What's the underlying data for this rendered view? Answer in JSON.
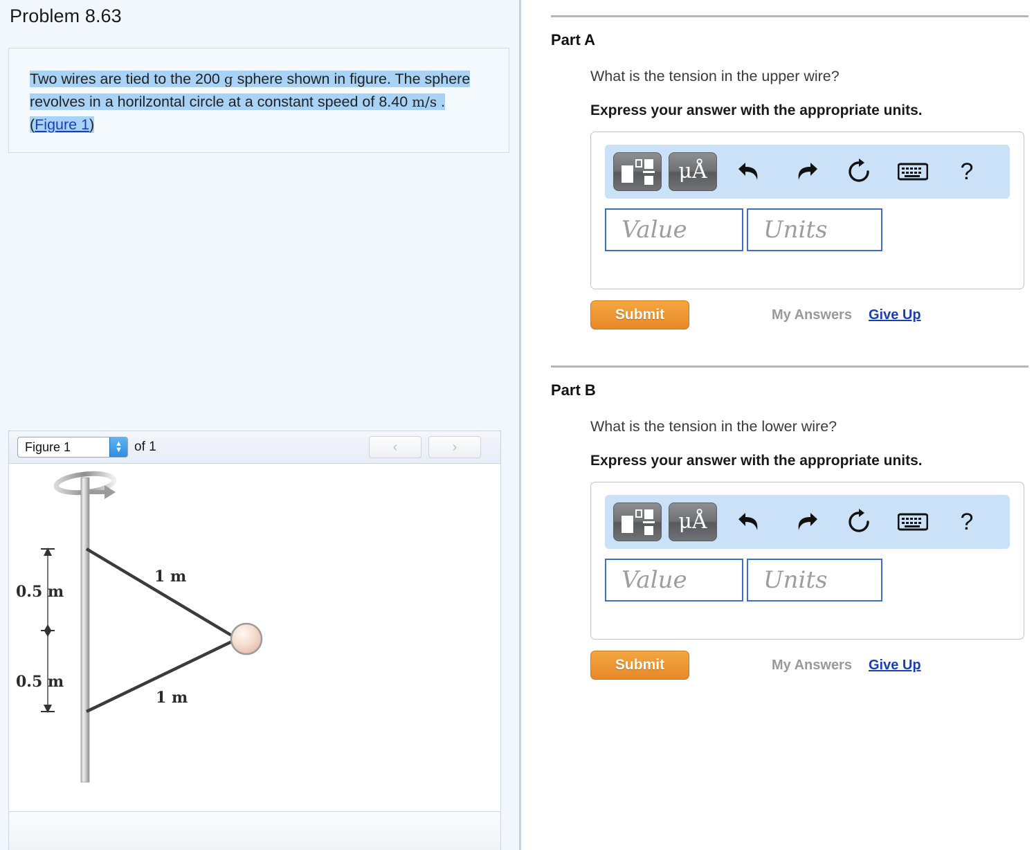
{
  "problem": {
    "title": "Problem 8.63",
    "statement_pre": "Two wires are tied to the 200 ",
    "statement_g": "g",
    "statement_mid": " sphere shown in figure. The sphere revolves in a horilzontal circle at a constant speed of 8.40 ",
    "statement_units": "m/s",
    "statement_post": " . (",
    "figure_link": "Figure 1",
    "statement_end": ")"
  },
  "figure": {
    "select_value": "Figure 1",
    "of_label": "of 1",
    "prev_icon": "chevron-left-icon",
    "next_icon": "chevron-right-icon",
    "diagram": {
      "upper_wire_label": "1 m",
      "lower_wire_label": "1 m",
      "upper_dim_label": "0.5 m",
      "lower_dim_label": "0.5 m"
    }
  },
  "parts": [
    {
      "heading": "Part A",
      "question": "What is the tension in the upper wire?",
      "instruction": "Express your answer with the appropriate units.",
      "toolbar": {
        "template_icon": "math-template-icon",
        "units_icon": "micro-angstrom-icon",
        "undo_icon": "undo-icon",
        "redo_icon": "redo-icon",
        "reset_icon": "reset-icon",
        "keyboard_icon": "keyboard-icon",
        "help_icon": "?"
      },
      "value_placeholder": "Value",
      "units_placeholder": "Units",
      "value": "",
      "units": "",
      "submit_label": "Submit",
      "my_answers_label": "My Answers",
      "give_up_label": "Give Up"
    },
    {
      "heading": "Part B",
      "question": "What is the tension in the lower wire?",
      "instruction": "Express your answer with the appropriate units.",
      "toolbar": {
        "template_icon": "math-template-icon",
        "units_icon": "micro-angstrom-icon",
        "undo_icon": "undo-icon",
        "redo_icon": "redo-icon",
        "reset_icon": "reset-icon",
        "keyboard_icon": "keyboard-icon",
        "help_icon": "?"
      },
      "value_placeholder": "Value",
      "units_placeholder": "Units",
      "value": "",
      "units": "",
      "submit_label": "Submit",
      "my_answers_label": "My Answers",
      "give_up_label": "Give Up"
    }
  ],
  "colors": {
    "panel_bg": "#f2f7fd",
    "highlight": "#a8d3f7",
    "link": "#1a3fb0",
    "submit": "#e8882a",
    "toolbar_bg": "#cbe1f7",
    "input_border": "#3c6fc4"
  }
}
